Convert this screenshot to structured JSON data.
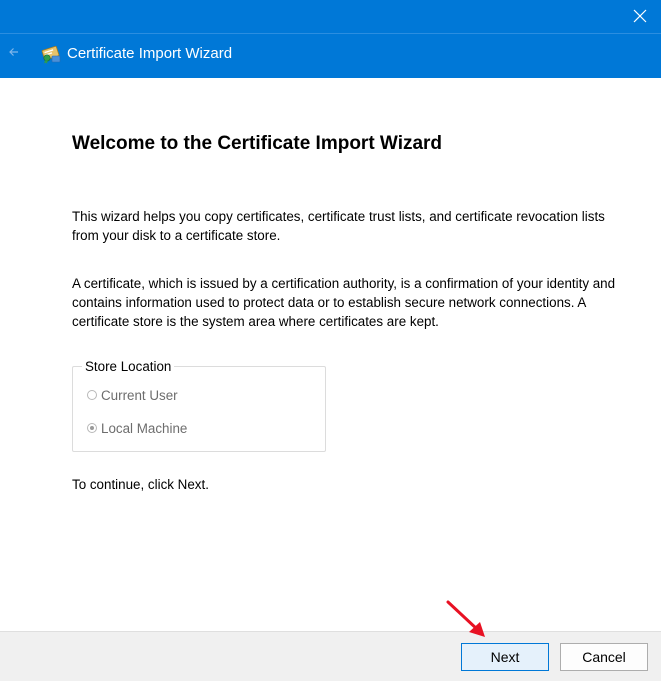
{
  "window": {
    "title": "Certificate Import Wizard",
    "accent_color": "#0078d7",
    "close_icon": "close-icon",
    "back_icon": "back-arrow-icon",
    "app_icon": "certificate-icon"
  },
  "content": {
    "heading": "Welcome to the Certificate Import Wizard",
    "paragraph1": "This wizard helps you copy certificates, certificate trust lists, and certificate revocation lists from your disk to a certificate store.",
    "paragraph2": "A certificate, which is issued by a certification authority, is a confirmation of your identity and contains information used to protect data or to establish secure network connections. A certificate store is the system area where certificates are kept.",
    "store_location": {
      "label": "Store Location",
      "options": [
        {
          "label": "Current User",
          "selected": false,
          "enabled": false
        },
        {
          "label": "Local Machine",
          "selected": true,
          "enabled": false
        }
      ]
    },
    "continue_text": "To continue, click Next."
  },
  "footer": {
    "next_label": "Next",
    "cancel_label": "Cancel"
  },
  "annotation": {
    "arrow_color": "#e81123",
    "arrow_icon": "red-arrow-pointer"
  }
}
